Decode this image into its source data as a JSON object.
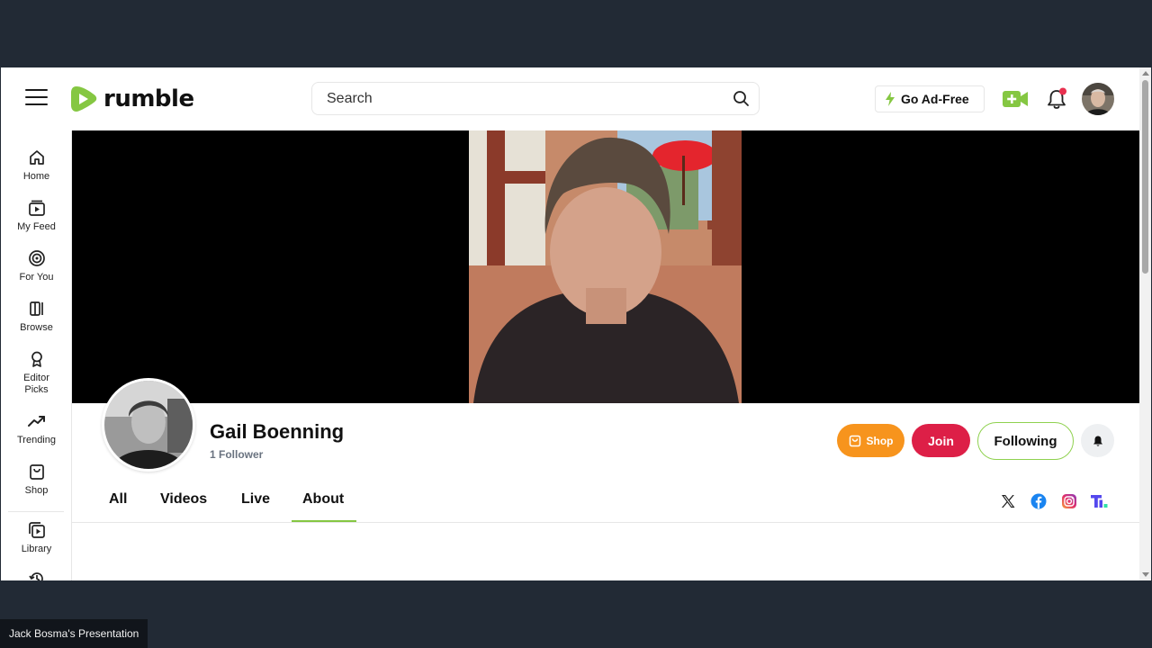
{
  "header": {
    "logo_text": "rumble",
    "search_placeholder": "Search",
    "go_ad_free_label": "Go Ad-Free"
  },
  "sidebar": {
    "items": [
      {
        "label": "Home",
        "icon": "home-icon"
      },
      {
        "label": "My Feed",
        "icon": "feed-icon"
      },
      {
        "label": "For You",
        "icon": "target-icon"
      },
      {
        "label": "Browse",
        "icon": "browse-icon"
      },
      {
        "label": "Editor Picks",
        "icon": "award-icon"
      },
      {
        "label": "Trending",
        "icon": "trending-icon"
      },
      {
        "label": "Shop",
        "icon": "shop-icon"
      },
      {
        "label": "Library",
        "icon": "library-icon"
      }
    ]
  },
  "channel": {
    "name": "Gail Boenning",
    "followers": "1 Follower",
    "shop_label": "Shop",
    "join_label": "Join",
    "following_label": "Following"
  },
  "tabs": [
    {
      "label": "All",
      "active": false
    },
    {
      "label": "Videos",
      "active": false
    },
    {
      "label": "Live",
      "active": false
    },
    {
      "label": "About",
      "active": true
    }
  ],
  "social_links": [
    "x-icon",
    "facebook-icon",
    "instagram-icon",
    "truth-social-icon"
  ],
  "colors": {
    "brand_green": "#85c742",
    "shop_orange": "#f7941d",
    "join_red": "#dd1f47",
    "frame_background": "#222a35"
  },
  "presenter_label": "Jack Bosma's Presentation"
}
